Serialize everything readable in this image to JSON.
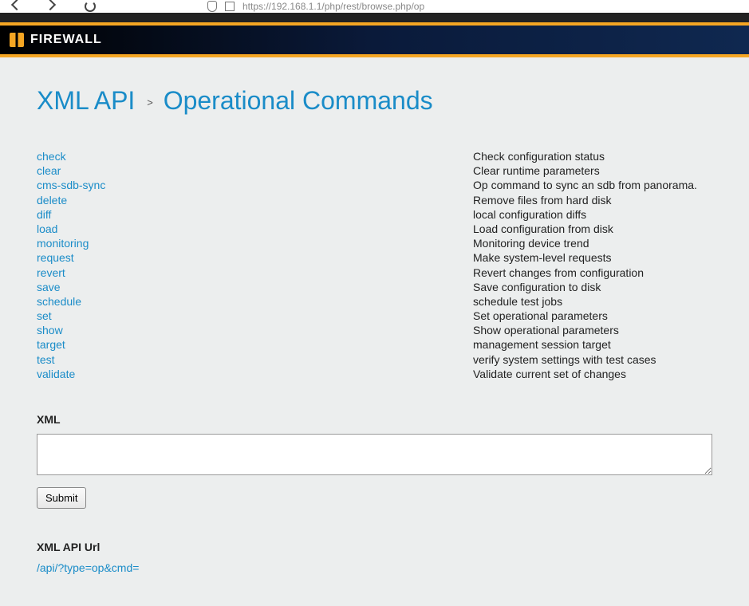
{
  "browser": {
    "url_display": "https://192.168.1.1/php/rest/browse.php/op"
  },
  "header": {
    "brand": "FIREWALL"
  },
  "title": {
    "left": "XML API",
    "sep": ">",
    "right": "Operational Commands"
  },
  "commands": [
    {
      "name": "check",
      "desc": "Check configuration status"
    },
    {
      "name": "clear",
      "desc": "Clear runtime parameters"
    },
    {
      "name": "cms-sdb-sync",
      "desc": "Op command to sync an sdb from panorama."
    },
    {
      "name": "delete",
      "desc": "Remove files from hard disk"
    },
    {
      "name": "diff",
      "desc": "local configuration diffs"
    },
    {
      "name": "load",
      "desc": "Load configuration from disk"
    },
    {
      "name": "monitoring",
      "desc": "Monitoring device trend"
    },
    {
      "name": "request",
      "desc": "Make system-level requests"
    },
    {
      "name": "revert",
      "desc": "Revert changes from configuration"
    },
    {
      "name": "save",
      "desc": "Save configuration to disk"
    },
    {
      "name": "schedule",
      "desc": "schedule test jobs"
    },
    {
      "name": "set",
      "desc": "Set operational parameters"
    },
    {
      "name": "show",
      "desc": "Show operational parameters"
    },
    {
      "name": "target",
      "desc": "management session target"
    },
    {
      "name": "test",
      "desc": "verify system settings with test cases"
    },
    {
      "name": "validate",
      "desc": "Validate current set of changes"
    }
  ],
  "sections": {
    "xml_label": "XML",
    "xml_value": "",
    "submit_label": "Submit",
    "api_url_label": "XML API Url",
    "api_url_value": "/api/?type=op&cmd="
  }
}
